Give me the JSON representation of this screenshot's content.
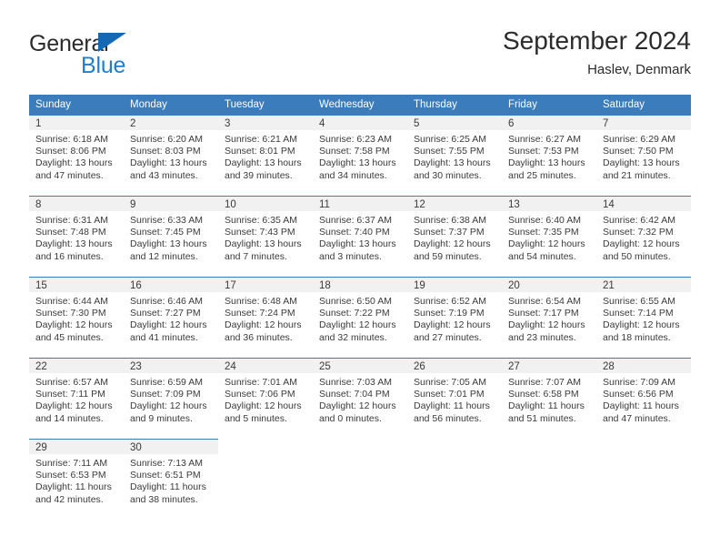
{
  "brand": {
    "name_top": "General",
    "name_bottom": "Blue",
    "icon": "triangle-logo-icon",
    "color_dark": "#2b2b2b",
    "color_blue": "#1d7fd0"
  },
  "header": {
    "title": "September 2024",
    "subtitle": "Haslev, Denmark"
  },
  "theme": {
    "header_blue": "#3b7cbd",
    "daynum_bg": "#f1f1f1",
    "text": "#3a3a3a"
  },
  "weekday_headers": [
    "Sunday",
    "Monday",
    "Tuesday",
    "Wednesday",
    "Thursday",
    "Friday",
    "Saturday"
  ],
  "weeks": [
    [
      {
        "day": "1",
        "sunrise": "Sunrise: 6:18 AM",
        "sunset": "Sunset: 8:06 PM",
        "daylight_1": "Daylight: 13 hours",
        "daylight_2": "and 47 minutes."
      },
      {
        "day": "2",
        "sunrise": "Sunrise: 6:20 AM",
        "sunset": "Sunset: 8:03 PM",
        "daylight_1": "Daylight: 13 hours",
        "daylight_2": "and 43 minutes."
      },
      {
        "day": "3",
        "sunrise": "Sunrise: 6:21 AM",
        "sunset": "Sunset: 8:01 PM",
        "daylight_1": "Daylight: 13 hours",
        "daylight_2": "and 39 minutes."
      },
      {
        "day": "4",
        "sunrise": "Sunrise: 6:23 AM",
        "sunset": "Sunset: 7:58 PM",
        "daylight_1": "Daylight: 13 hours",
        "daylight_2": "and 34 minutes."
      },
      {
        "day": "5",
        "sunrise": "Sunrise: 6:25 AM",
        "sunset": "Sunset: 7:55 PM",
        "daylight_1": "Daylight: 13 hours",
        "daylight_2": "and 30 minutes."
      },
      {
        "day": "6",
        "sunrise": "Sunrise: 6:27 AM",
        "sunset": "Sunset: 7:53 PM",
        "daylight_1": "Daylight: 13 hours",
        "daylight_2": "and 25 minutes."
      },
      {
        "day": "7",
        "sunrise": "Sunrise: 6:29 AM",
        "sunset": "Sunset: 7:50 PM",
        "daylight_1": "Daylight: 13 hours",
        "daylight_2": "and 21 minutes."
      }
    ],
    [
      {
        "day": "8",
        "sunrise": "Sunrise: 6:31 AM",
        "sunset": "Sunset: 7:48 PM",
        "daylight_1": "Daylight: 13 hours",
        "daylight_2": "and 16 minutes."
      },
      {
        "day": "9",
        "sunrise": "Sunrise: 6:33 AM",
        "sunset": "Sunset: 7:45 PM",
        "daylight_1": "Daylight: 13 hours",
        "daylight_2": "and 12 minutes."
      },
      {
        "day": "10",
        "sunrise": "Sunrise: 6:35 AM",
        "sunset": "Sunset: 7:43 PM",
        "daylight_1": "Daylight: 13 hours",
        "daylight_2": "and 7 minutes."
      },
      {
        "day": "11",
        "sunrise": "Sunrise: 6:37 AM",
        "sunset": "Sunset: 7:40 PM",
        "daylight_1": "Daylight: 13 hours",
        "daylight_2": "and 3 minutes."
      },
      {
        "day": "12",
        "sunrise": "Sunrise: 6:38 AM",
        "sunset": "Sunset: 7:37 PM",
        "daylight_1": "Daylight: 12 hours",
        "daylight_2": "and 59 minutes."
      },
      {
        "day": "13",
        "sunrise": "Sunrise: 6:40 AM",
        "sunset": "Sunset: 7:35 PM",
        "daylight_1": "Daylight: 12 hours",
        "daylight_2": "and 54 minutes."
      },
      {
        "day": "14",
        "sunrise": "Sunrise: 6:42 AM",
        "sunset": "Sunset: 7:32 PM",
        "daylight_1": "Daylight: 12 hours",
        "daylight_2": "and 50 minutes."
      }
    ],
    [
      {
        "day": "15",
        "sunrise": "Sunrise: 6:44 AM",
        "sunset": "Sunset: 7:30 PM",
        "daylight_1": "Daylight: 12 hours",
        "daylight_2": "and 45 minutes."
      },
      {
        "day": "16",
        "sunrise": "Sunrise: 6:46 AM",
        "sunset": "Sunset: 7:27 PM",
        "daylight_1": "Daylight: 12 hours",
        "daylight_2": "and 41 minutes."
      },
      {
        "day": "17",
        "sunrise": "Sunrise: 6:48 AM",
        "sunset": "Sunset: 7:24 PM",
        "daylight_1": "Daylight: 12 hours",
        "daylight_2": "and 36 minutes."
      },
      {
        "day": "18",
        "sunrise": "Sunrise: 6:50 AM",
        "sunset": "Sunset: 7:22 PM",
        "daylight_1": "Daylight: 12 hours",
        "daylight_2": "and 32 minutes."
      },
      {
        "day": "19",
        "sunrise": "Sunrise: 6:52 AM",
        "sunset": "Sunset: 7:19 PM",
        "daylight_1": "Daylight: 12 hours",
        "daylight_2": "and 27 minutes."
      },
      {
        "day": "20",
        "sunrise": "Sunrise: 6:54 AM",
        "sunset": "Sunset: 7:17 PM",
        "daylight_1": "Daylight: 12 hours",
        "daylight_2": "and 23 minutes."
      },
      {
        "day": "21",
        "sunrise": "Sunrise: 6:55 AM",
        "sunset": "Sunset: 7:14 PM",
        "daylight_1": "Daylight: 12 hours",
        "daylight_2": "and 18 minutes."
      }
    ],
    [
      {
        "day": "22",
        "sunrise": "Sunrise: 6:57 AM",
        "sunset": "Sunset: 7:11 PM",
        "daylight_1": "Daylight: 12 hours",
        "daylight_2": "and 14 minutes."
      },
      {
        "day": "23",
        "sunrise": "Sunrise: 6:59 AM",
        "sunset": "Sunset: 7:09 PM",
        "daylight_1": "Daylight: 12 hours",
        "daylight_2": "and 9 minutes."
      },
      {
        "day": "24",
        "sunrise": "Sunrise: 7:01 AM",
        "sunset": "Sunset: 7:06 PM",
        "daylight_1": "Daylight: 12 hours",
        "daylight_2": "and 5 minutes."
      },
      {
        "day": "25",
        "sunrise": "Sunrise: 7:03 AM",
        "sunset": "Sunset: 7:04 PM",
        "daylight_1": "Daylight: 12 hours",
        "daylight_2": "and 0 minutes."
      },
      {
        "day": "26",
        "sunrise": "Sunrise: 7:05 AM",
        "sunset": "Sunset: 7:01 PM",
        "daylight_1": "Daylight: 11 hours",
        "daylight_2": "and 56 minutes."
      },
      {
        "day": "27",
        "sunrise": "Sunrise: 7:07 AM",
        "sunset": "Sunset: 6:58 PM",
        "daylight_1": "Daylight: 11 hours",
        "daylight_2": "and 51 minutes."
      },
      {
        "day": "28",
        "sunrise": "Sunrise: 7:09 AM",
        "sunset": "Sunset: 6:56 PM",
        "daylight_1": "Daylight: 11 hours",
        "daylight_2": "and 47 minutes."
      }
    ],
    [
      {
        "day": "29",
        "sunrise": "Sunrise: 7:11 AM",
        "sunset": "Sunset: 6:53 PM",
        "daylight_1": "Daylight: 11 hours",
        "daylight_2": "and 42 minutes."
      },
      {
        "day": "30",
        "sunrise": "Sunrise: 7:13 AM",
        "sunset": "Sunset: 6:51 PM",
        "daylight_1": "Daylight: 11 hours",
        "daylight_2": "and 38 minutes."
      },
      null,
      null,
      null,
      null,
      null
    ]
  ]
}
